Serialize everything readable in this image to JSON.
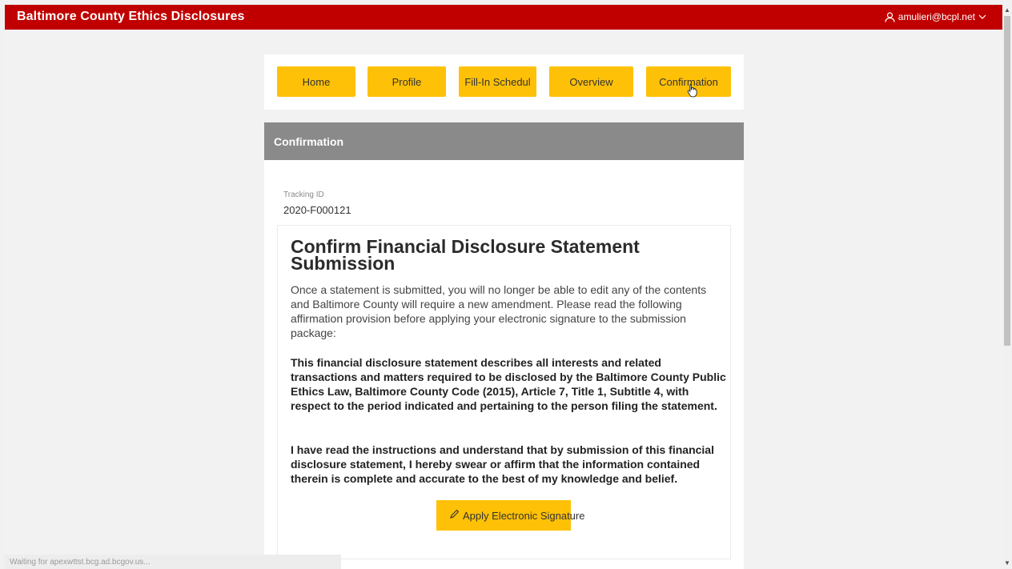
{
  "app": {
    "title": "Baltimore County Ethics Disclosures",
    "user": "amulieri@bcpl.net",
    "accent_color": "#c00000",
    "button_color": "#ffc107"
  },
  "nav": {
    "home": "Home",
    "profile": "Profile",
    "fill_in": "Fill-In Schedul",
    "overview": "Overview",
    "confirmation": "Confirmation"
  },
  "panel": {
    "title": "Confirmation",
    "tracking_label": "Tracking ID",
    "tracking_value": "2020-F000121"
  },
  "confirm": {
    "heading": "Confirm Financial Disclosure Statement Submission",
    "intro": "Once a statement is submitted, you will no longer be able to edit any of the contents and Baltimore County will require a new amendment. Please read the following affirmation provision before applying your electronic signature to the submission package:",
    "affirmation_1": "This financial disclosure statement describes all interests and related transactions and matters required to be disclosed by the Baltimore County Public Ethics Law, Baltimore County Code (2015), Article 7, Title 1, Subtitle 4, with respect to the period indicated and pertaining to the person filing the statement.",
    "affirmation_2": "I have read the instructions and understand that by submission of this financial disclosure statement, I hereby swear or affirm that the information contained therein is complete and accurate to the best of my knowledge and belief.",
    "sign_button": "Apply Electronic Signature"
  },
  "status_bar": {
    "text": "Waiting for apexwttst.bcg.ad.bcgov.us..."
  },
  "icons": {
    "user": "user-icon",
    "chevron": "chevron-down-icon",
    "pencil": "pencil-icon"
  }
}
